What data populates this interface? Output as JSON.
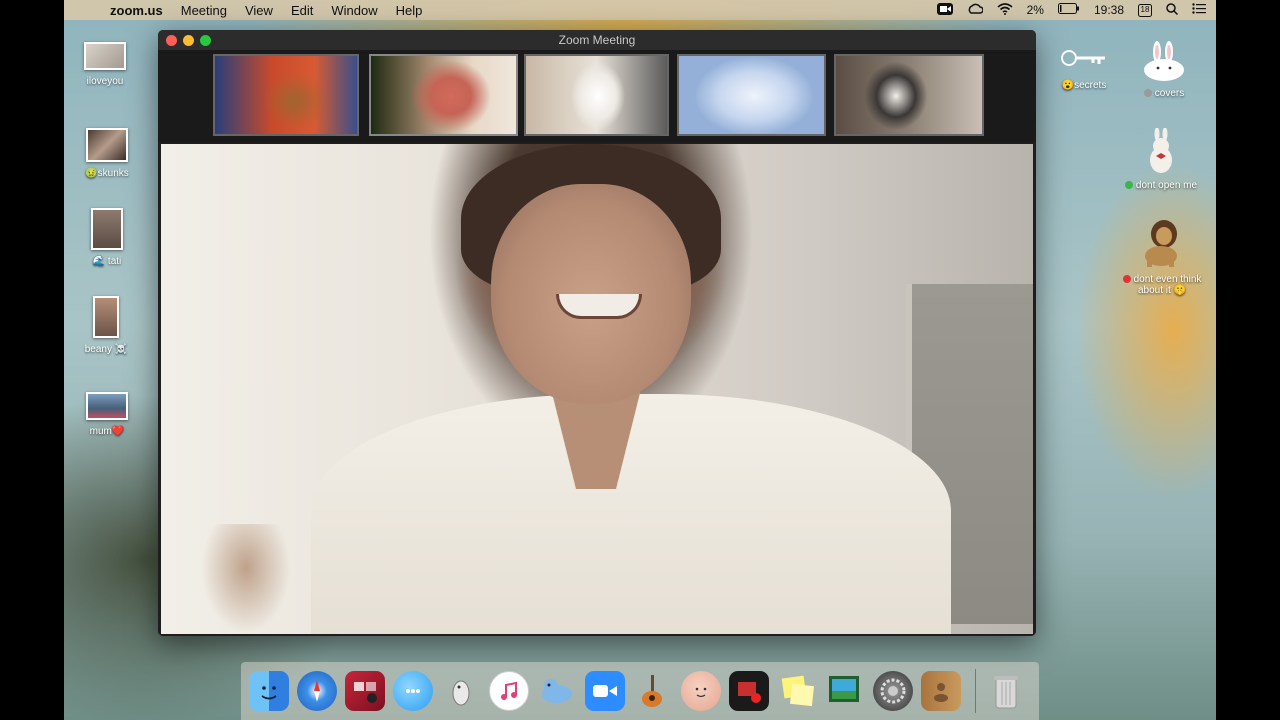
{
  "menubar": {
    "app": "zoom.us",
    "menus": [
      "Meeting",
      "View",
      "Edit",
      "Window",
      "Help"
    ],
    "battery": "2%",
    "time": "19:38",
    "calendar_day": "18"
  },
  "desktop_left": [
    {
      "label": "iloveyou"
    },
    {
      "label": "🤢skunks"
    },
    {
      "label": "🌊 tati"
    },
    {
      "label": "beany ☠️"
    },
    {
      "label": "mum❤️"
    }
  ],
  "desktop_right": [
    {
      "label": "😮secrets"
    },
    {
      "label": "covers"
    },
    {
      "label": "dont open me"
    },
    {
      "label": "dont even think about it 🤫"
    }
  ],
  "zoom": {
    "title": "Zoom Meeting",
    "thumbnails": [
      "dachshund on sofa",
      "blurry pink close-up",
      "white terrier",
      "white fur close-up",
      "husky"
    ]
  },
  "dock": {
    "icons": [
      "finder-icon",
      "safari-icon",
      "photo-booth-icon",
      "messages-icon",
      "inkscape-icon",
      "itunes-icon",
      "sequel-pro-icon",
      "zoom-icon",
      "garageband-icon",
      "avatar-app-icon",
      "screenflow-icon",
      "stickies-icon",
      "preview-icon",
      "system-preferences-icon",
      "contacts-icon",
      "trash-icon"
    ]
  },
  "colors": {
    "traffic_red": "#fe5f57",
    "traffic_yellow": "#febc2e",
    "traffic_green": "#28c840",
    "zoom_blue": "#2d8cff"
  }
}
